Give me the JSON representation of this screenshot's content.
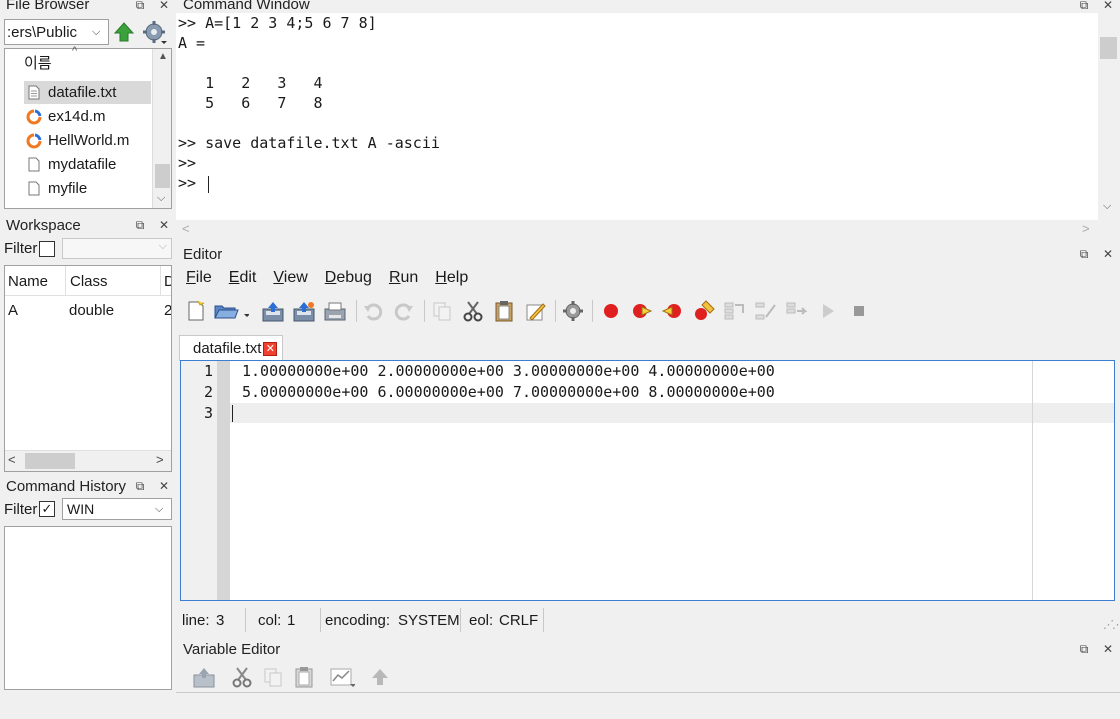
{
  "file_browser": {
    "title": "File Browser",
    "path": ":ers\\Public",
    "column_header": "이름",
    "files": [
      {
        "name": "datafile.txt",
        "icon": "text-file-icon",
        "selected": true
      },
      {
        "name": "ex14d.m",
        "icon": "octave-script-icon",
        "selected": false
      },
      {
        "name": "HellWorld.m",
        "icon": "octave-script-icon",
        "selected": false
      },
      {
        "name": "mydatafile",
        "icon": "blank-file-icon",
        "selected": false
      },
      {
        "name": "myfile",
        "icon": "blank-file-icon",
        "selected": false
      }
    ]
  },
  "workspace": {
    "title": "Workspace",
    "filter_label": "Filter",
    "filter_checked": false,
    "columns": [
      "Name",
      "Class",
      "D"
    ],
    "rows": [
      {
        "name": "A",
        "class": "double",
        "dim": "2"
      }
    ]
  },
  "command_history": {
    "title": "Command History",
    "filter_label": "Filter",
    "filter_checked": true,
    "filter_value": "WIN"
  },
  "command_window": {
    "title": "Command Window",
    "lines": [
      ">> A=[1 2 3 4;5 6 7 8]",
      "A =",
      "",
      "   1   2   3   4",
      "   5   6   7   8",
      "",
      ">> save datafile.txt A -ascii",
      ">>",
      ">> "
    ]
  },
  "editor": {
    "title": "Editor",
    "menu": [
      {
        "label": "File",
        "key": "F",
        "rest": "ile"
      },
      {
        "label": "Edit",
        "key": "E",
        "rest": "dit"
      },
      {
        "label": "View",
        "key": "V",
        "rest": "iew"
      },
      {
        "label": "Debug",
        "key": "D",
        "rest": "ebug"
      },
      {
        "label": "Run",
        "key": "R",
        "rest": "un"
      },
      {
        "label": "Help",
        "key": "H",
        "rest": "elp"
      }
    ],
    "tab_label": "datafile.txt",
    "line_numbers": [
      "1",
      "2",
      "3"
    ],
    "code_lines": [
      "1.00000000e+00 2.00000000e+00 3.00000000e+00 4.00000000e+00",
      "5.00000000e+00 6.00000000e+00 7.00000000e+00 8.00000000e+00",
      ""
    ],
    "status": {
      "line_label": "line:",
      "line_value": "3",
      "col_label": "col:",
      "col_value": "1",
      "encoding_label": "encoding:",
      "encoding_value": "SYSTEM",
      "eol_label": "eol:",
      "eol_value": "CRLF"
    }
  },
  "variable_editor": {
    "title": "Variable Editor"
  },
  "colors": {
    "breakpoint_red": "#e02020",
    "focus_blue": "#3c7fd0",
    "octave_orange": "#f07820",
    "octave_blue": "#2a6fd6",
    "up_arrow_green": "#3aa23a"
  }
}
